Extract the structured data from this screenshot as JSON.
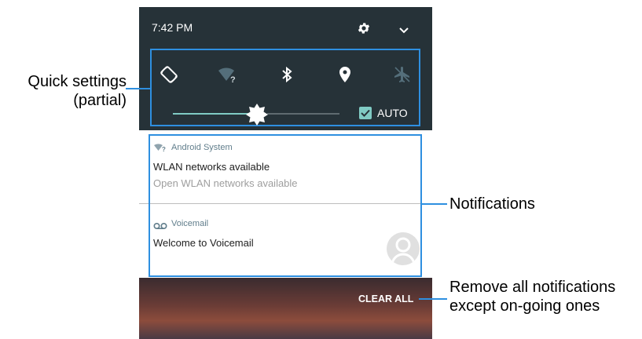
{
  "status_bar": {
    "time": "7:42 PM",
    "settings_icon": "gear-icon",
    "expand_icon": "chevron-down-icon"
  },
  "quick_settings": {
    "tiles": [
      {
        "name": "auto-rotate",
        "icon": "rotate-icon",
        "state": "on"
      },
      {
        "name": "wifi",
        "icon": "wifi-unknown-icon",
        "state": "dim"
      },
      {
        "name": "bluetooth",
        "icon": "bluetooth-icon",
        "state": "on"
      },
      {
        "name": "location",
        "icon": "location-pin-icon",
        "state": "on"
      },
      {
        "name": "airplane-mode",
        "icon": "airplane-icon",
        "state": "off"
      }
    ],
    "brightness_level": 0.45,
    "auto_label": "AUTO",
    "auto_checked": true
  },
  "notifications": [
    {
      "app": "Android System",
      "app_icon": "wifi-question-icon",
      "title": "WLAN networks available",
      "text": "Open WLAN networks available"
    },
    {
      "app": "Voicemail",
      "app_icon": "voicemail-icon",
      "title": "Welcome to Voicemail",
      "avatar_icon": "person-avatar-icon"
    }
  ],
  "clear_all_label": "CLEAR ALL",
  "callouts": {
    "quick_settings_line1": "Quick settings",
    "quick_settings_line2": "(partial)",
    "notifications": "Notifications",
    "clear_line1": "Remove all notifications",
    "clear_line2": "except on-going ones"
  },
  "colors": {
    "panel_bg": "#263238",
    "accent": "#80cbc4",
    "callout_line": "#2e8fe0"
  }
}
